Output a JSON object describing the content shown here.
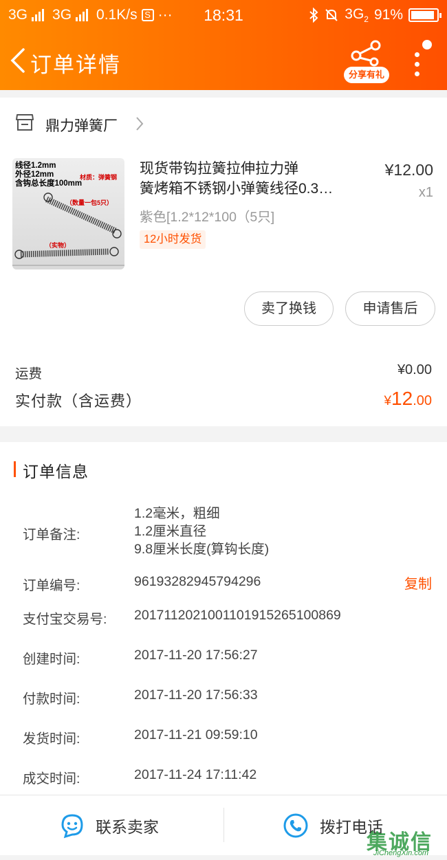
{
  "status_bar": {
    "network1": "3G",
    "network2": "3G",
    "speed": "0.1K/s",
    "time": "18:31",
    "network3": "3G",
    "network3_sub": "2",
    "battery": "91%"
  },
  "nav": {
    "title": "订单详情",
    "share_label": "分享有礼"
  },
  "shop": {
    "name": "鼎力弹簧厂"
  },
  "product": {
    "image_lines": [
      "线径1.2mm",
      "外径12mm",
      "含钩总长度100mm"
    ],
    "image_material": "材质：弹簧钢",
    "image_count": "（数量一包5只）",
    "image_real": "（实物）",
    "title_line1": "现货带钩拉簧拉伸拉力弹",
    "title_line2": "簧烤箱不锈钢小弹簧线径0.3…",
    "sku": "紫色[1.2*12*100（5只]",
    "ship_tag": "12小时发货",
    "price": "¥12.00",
    "qty": "x1"
  },
  "actions": {
    "exchange": "卖了换钱",
    "after_sale": "申请售后"
  },
  "fees": {
    "shipping_label": "运费",
    "shipping_value": "¥0.00",
    "paid_label": "实付款（含运费）",
    "paid_currency": "¥",
    "paid_int": "12",
    "paid_dec": ".00"
  },
  "order_info": {
    "title": "订单信息",
    "remark_label": "订单备注:",
    "remark_lines": [
      "1.2毫米，粗细",
      "1.2厘米直径",
      "9.8厘米长度(算钩长度)"
    ],
    "order_no_label": "订单编号:",
    "order_no": "96193282945794296",
    "copy": "复制",
    "alipay_label": "支付宝交易号:",
    "alipay_no": "2017112021001101915265100869",
    "created_label": "创建时间:",
    "created": "2017-11-20 17:56:27",
    "paid_label": "付款时间:",
    "paid": "2017-11-20 17:56:33",
    "shipped_label": "发货时间:",
    "shipped": "2017-11-21 09:59:10",
    "closed_label": "成交时间:",
    "closed": "2017-11-24 17:11:42"
  },
  "bottom": {
    "contact": "联系卖家",
    "call": "拨打电话"
  },
  "watermark": {
    "text": "集诚信",
    "url": "JiChengXin.com"
  },
  "colors": {
    "accent": "#ff5000",
    "header_start": "#ff8a00",
    "icon_blue": "#1e9be8"
  }
}
